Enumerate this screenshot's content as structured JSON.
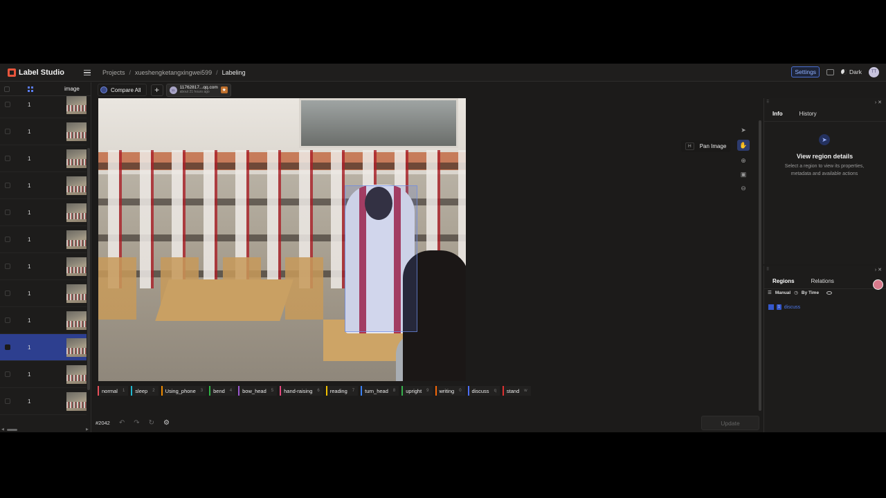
{
  "app": {
    "name": "Label Studio"
  },
  "breadcrumbs": [
    "Projects",
    "xueshengketangxingwei599",
    "Labeling"
  ],
  "header": {
    "settings_label": "Settings",
    "theme_label": "Dark",
    "user_initials": "TT"
  },
  "list": {
    "column_label": "image",
    "rows": [
      {
        "num": "1"
      },
      {
        "num": "1"
      },
      {
        "num": "1"
      },
      {
        "num": "1"
      },
      {
        "num": "1"
      },
      {
        "num": "1"
      },
      {
        "num": "1"
      },
      {
        "num": "1"
      },
      {
        "num": "1"
      },
      {
        "num": "1",
        "selected": true
      },
      {
        "num": "1"
      },
      {
        "num": "1"
      }
    ]
  },
  "tabs": {
    "compare_label": "Compare All",
    "add_label": "+",
    "annotation": {
      "user": "11762817...qq.com",
      "time": "about 21 hours ago",
      "avatar_initials": "11"
    }
  },
  "toolbar": {
    "tooltip_key": "H",
    "tooltip_label": "Pan Image",
    "tools": [
      "pointer-icon",
      "hand-icon",
      "zoom-in-icon",
      "fit-icon",
      "zoom-out-icon"
    ]
  },
  "labels": [
    {
      "name": "normal",
      "hotkey": "1",
      "color": "#e8505b"
    },
    {
      "name": "sleep",
      "hotkey": "2",
      "color": "#22b8cf"
    },
    {
      "name": "Using_phone",
      "hotkey": "3",
      "color": "#f08c00"
    },
    {
      "name": "bend",
      "hotkey": "4",
      "color": "#2fb344"
    },
    {
      "name": "bow_head",
      "hotkey": "5",
      "color": "#9b59d0"
    },
    {
      "name": "hand-raising",
      "hotkey": "6",
      "color": "#e64980"
    },
    {
      "name": "reading",
      "hotkey": "7",
      "color": "#f2c200"
    },
    {
      "name": "turn_head",
      "hotkey": "8",
      "color": "#3b82f6"
    },
    {
      "name": "upright",
      "hotkey": "9",
      "color": "#37b24d"
    },
    {
      "name": "writing",
      "hotkey": "0",
      "color": "#f76707"
    },
    {
      "name": "discuss",
      "hotkey": "q",
      "color": "#4c6ef5"
    },
    {
      "name": "stand",
      "hotkey": "w",
      "color": "#e03131"
    }
  ],
  "bottom": {
    "task_id": "#2042",
    "update_label": "Update"
  },
  "info_panel": {
    "tabs": [
      "Info",
      "History"
    ],
    "title": "View region details",
    "description": "Select a region to view its properties, metadata and available actions"
  },
  "regions_panel": {
    "tabs": [
      "Regions",
      "Relations"
    ],
    "filter_manual": "Manual",
    "filter_by": "By Time",
    "region": {
      "label": "discuss",
      "tag": "1"
    }
  },
  "accent_color": "#4c6ef5"
}
